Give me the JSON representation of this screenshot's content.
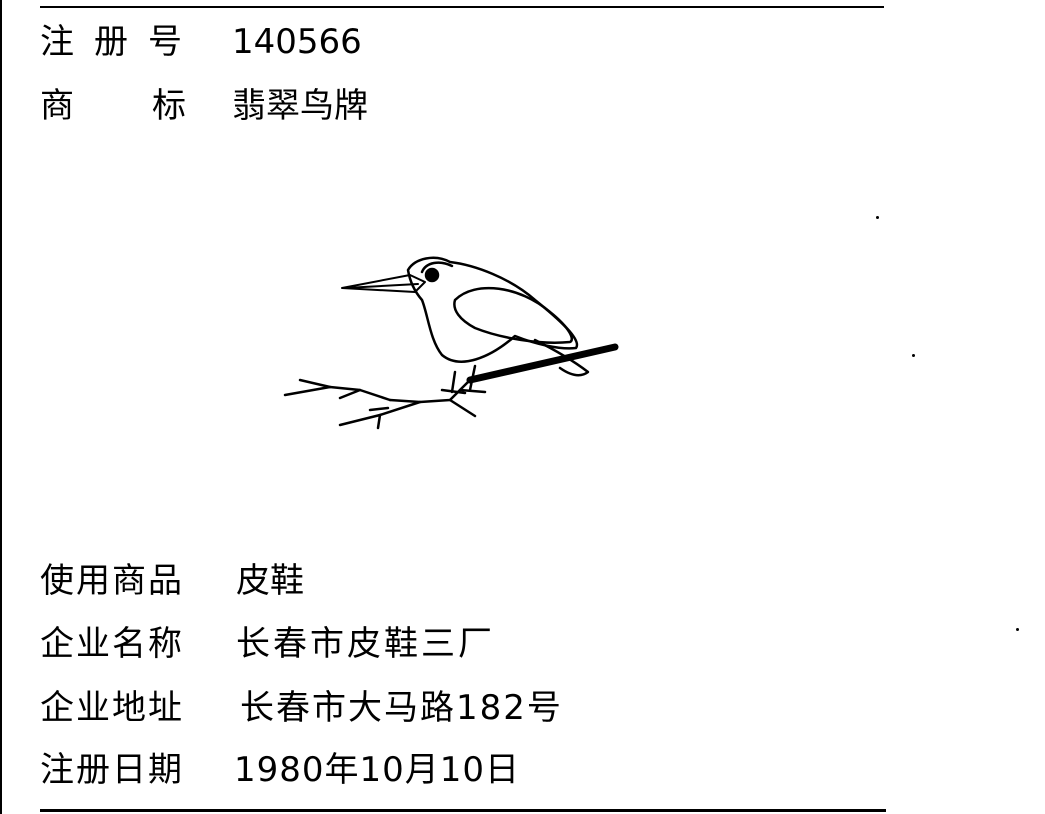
{
  "registration": {
    "number_label": "注册号",
    "number_value": "140566",
    "trademark_label": "商标",
    "trademark_value": "翡翠鸟牌",
    "goods_label": "使用商品",
    "goods_value": "皮鞋",
    "company_label": "企业名称",
    "company_value": "长春市皮鞋三厂",
    "address_label": "企业地址",
    "address_value": "长春市大马路182号",
    "date_label": "注册日期",
    "date_value": "1980年10月10日"
  },
  "logo": {
    "icon": "kingfisher-on-branch-icon"
  }
}
